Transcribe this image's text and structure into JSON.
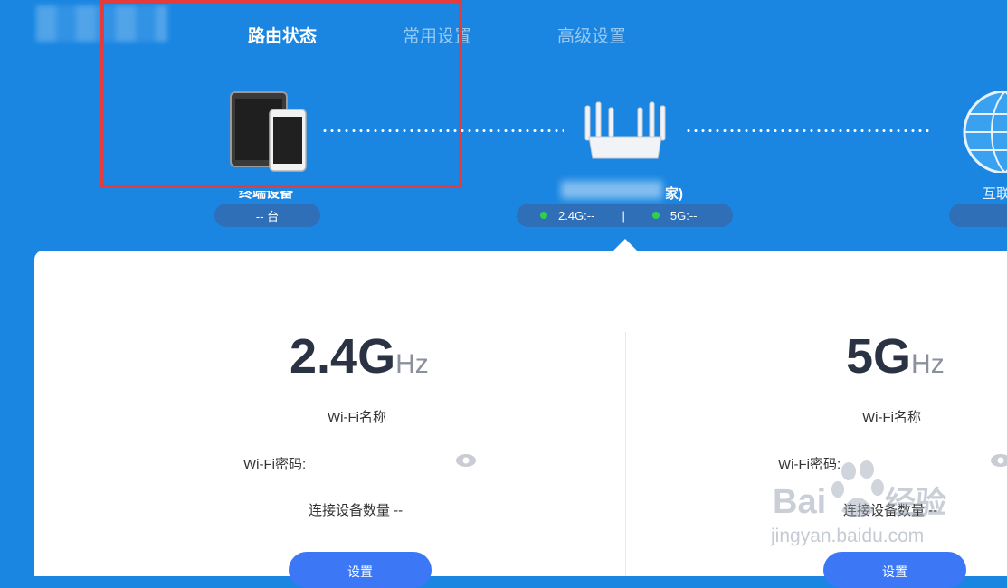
{
  "nav": {
    "tabs": [
      {
        "label": "路由状态",
        "active": true
      },
      {
        "label": "常用设置",
        "active": false
      },
      {
        "label": "高级设置",
        "active": false
      }
    ]
  },
  "topology": {
    "devices": {
      "label": "终端设备",
      "count_text": "-- 台"
    },
    "router": {
      "name_suffix": "家)",
      "band_24": "2.4G:--",
      "separator": "|",
      "band_5": "5G:--"
    },
    "internet": {
      "label": "互联"
    }
  },
  "wifi_24": {
    "band": "2.4G",
    "unit": "Hz",
    "name_label": "Wi-Fi名称",
    "password_label": "Wi-Fi密码:",
    "devices_text": "连接设备数量 --",
    "button_label": "设置"
  },
  "wifi_5": {
    "band": "5G",
    "unit": "Hz",
    "name_label": "Wi-Fi名称",
    "password_label": "Wi-Fi密码:",
    "devices_text": "连接设备数量 --",
    "button_label": "设置"
  },
  "watermark": {
    "brand": "Bai du 经验",
    "url": "jingyan.baidu.com"
  },
  "colors": {
    "background": "#1a86e2",
    "accent_button": "#3c78f5",
    "status_ok": "#2fd04a",
    "highlight": "#e53b3b"
  }
}
